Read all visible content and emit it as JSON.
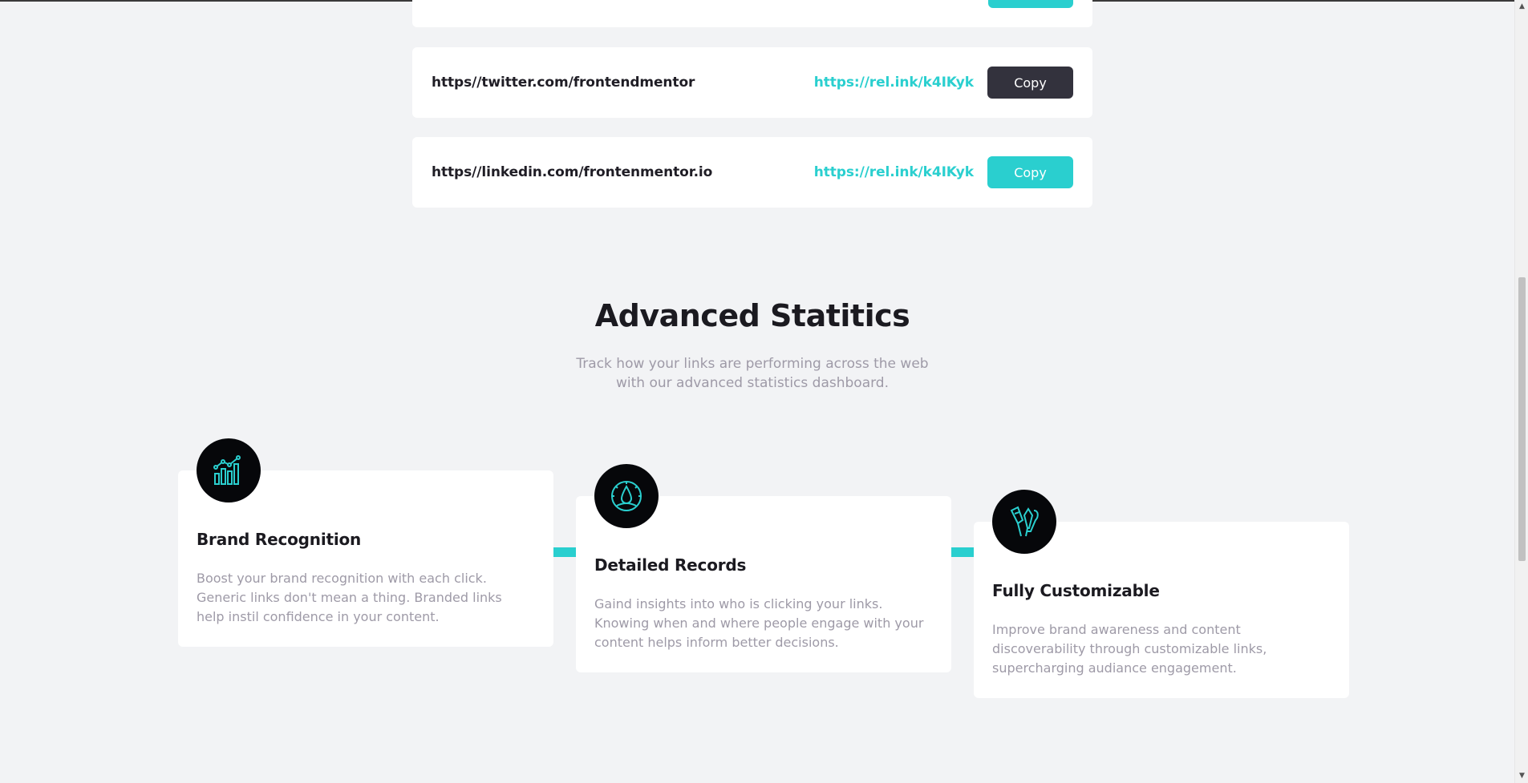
{
  "links": [
    {
      "original": "https//twitter.com/frontendmentor",
      "short": "https://rel.ink/k4IKyk",
      "button_label": "Copy",
      "state": "copied"
    },
    {
      "original": "https//linkedin.com/frontenmentor.io",
      "short": "https://rel.ink/k4IKyk",
      "button_label": "Copy",
      "state": "default"
    }
  ],
  "statistics": {
    "title": "Advanced Statitics",
    "subtitle": "Track how your links are performing across the web with our advanced statistics dashboard."
  },
  "features": [
    {
      "title": "Brand Recognition",
      "text": "Boost your brand recognition with each click. Generic links don't mean a thing. Branded links help instil confidence in your content.",
      "icon": "chart-icon"
    },
    {
      "title": "Detailed Records",
      "text": "Gaind insights into who is clicking your links. Knowing when and where people engage with your content helps inform better decisions.",
      "icon": "gauge-icon"
    },
    {
      "title": "Fully Customizable",
      "text": "Improve brand awareness and content discoverability through customizable links, supercharging audiance engagement.",
      "icon": "tools-icon"
    }
  ],
  "colors": {
    "accent": "#2acfcf",
    "dark_button": "#33323d",
    "background": "#f2f3f5"
  }
}
